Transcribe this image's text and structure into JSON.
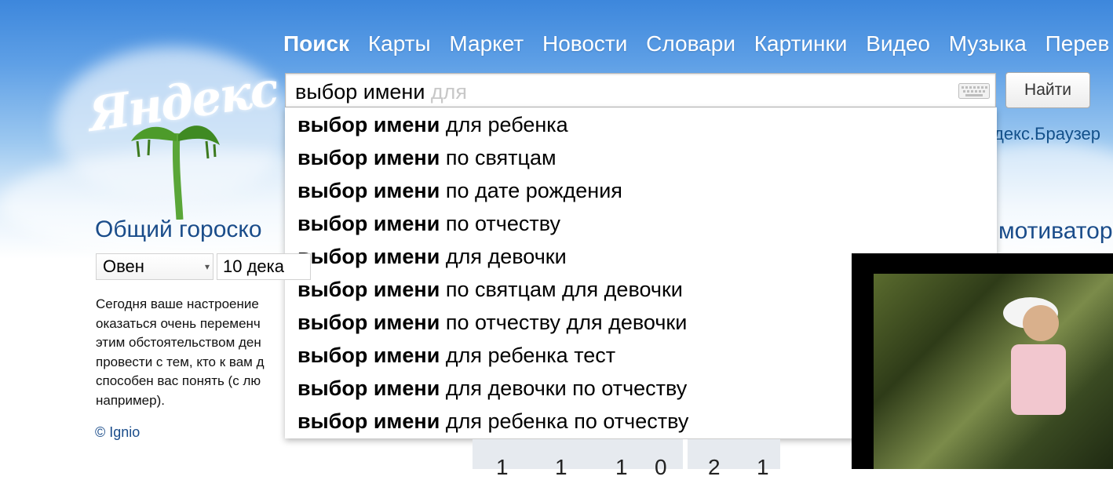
{
  "nav": {
    "items": [
      "Поиск",
      "Карты",
      "Маркет",
      "Новости",
      "Словари",
      "Картинки",
      "Видео",
      "Музыка",
      "Перев"
    ],
    "active": "Поиск"
  },
  "logo_text": "Яндекс",
  "search": {
    "value": "выбор имени",
    "hint": "для",
    "button_label": "Найти",
    "keyboard_icon": "keyboard-icon"
  },
  "suggestions": [
    {
      "bold": "выбор имени",
      "rest": " для ребенка"
    },
    {
      "bold": "выбор имени",
      "rest": " по святцам"
    },
    {
      "bold": "выбор имени",
      "rest": " по дате рождения"
    },
    {
      "bold": "выбор имени",
      "rest": " по отчеству"
    },
    {
      "bold": "выбор имени",
      "rest": " для девочки"
    },
    {
      "bold": "выбор имени",
      "rest": " по святцам для девочки"
    },
    {
      "bold": "выбор имени",
      "rest": " по отчеству для девочки"
    },
    {
      "bold": "выбор имени",
      "rest": " для ребенка тест"
    },
    {
      "bold": "выбор имени",
      "rest": " для девочки по отчеству"
    },
    {
      "bold": "выбор имени",
      "rest": " для ребенка по отчеству"
    }
  ],
  "browser_link": "декс.Браузер",
  "horoscope": {
    "title": "Общий гороско",
    "sign": "Овен",
    "date": "10 дека",
    "text_lines": [
      "Сегодня ваше настроение",
      "оказаться очень переменч",
      "этим обстоятельством ден",
      "провести с тем, кто к вам д",
      "способен вас понять (с лю",
      "например)."
    ],
    "credit": "© Ignio"
  },
  "numbers": [
    "1",
    "1",
    "1",
    "0",
    "2",
    "1"
  ],
  "motivator_title": "мотиватор",
  "colors": {
    "link": "#13508a",
    "heading": "#1a4c8a",
    "hint": "#c8c8c8"
  }
}
